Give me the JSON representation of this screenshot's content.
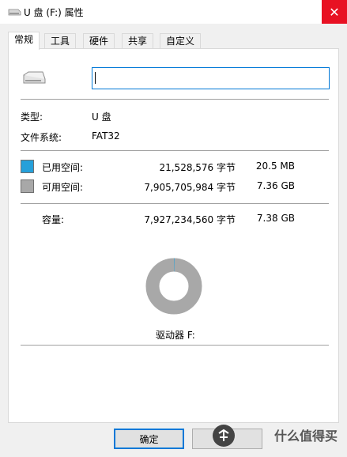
{
  "window": {
    "title": "U 盘 (F:) 属性",
    "close_glyph": "✕"
  },
  "tabs": [
    {
      "label": "常规"
    },
    {
      "label": "工具"
    },
    {
      "label": "硬件"
    },
    {
      "label": "共享"
    },
    {
      "label": "自定义"
    }
  ],
  "general": {
    "name_value": "",
    "type_label": "类型:",
    "type_value": "U 盘",
    "fs_label": "文件系统:",
    "fs_value": "FAT32",
    "used_label": "已用空间:",
    "used_bytes": "21,528,576 字节",
    "used_size": "20.5 MB",
    "free_label": "可用空间:",
    "free_bytes": "7,905,705,984 字节",
    "free_size": "7.36 GB",
    "capacity_label": "容量:",
    "capacity_bytes": "7,927,234,560 字节",
    "capacity_size": "7.38 GB",
    "drive_label": "驱动器 F:",
    "used_fraction": 0.0027,
    "colors": {
      "used": "#26a0da",
      "free": "#a8a8a8"
    }
  },
  "buttons": {
    "ok": "确定",
    "cancel": ""
  },
  "watermark": {
    "text": "什么值得买"
  }
}
